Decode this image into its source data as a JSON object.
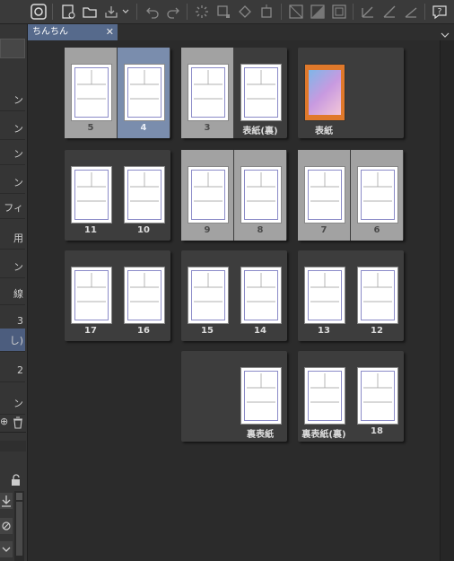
{
  "document_tab": {
    "title": "ちんちん",
    "close_glyph": "✕"
  },
  "left_panel": {
    "items": [
      "ン",
      "ン",
      "ン",
      "ン",
      "フィ",
      "用",
      "ン",
      "線",
      "3",
      "し)",
      "2",
      "ン"
    ]
  },
  "spreads": [
    {
      "pages": [
        {
          "label": "5",
          "state": "selected"
        },
        {
          "label": "4",
          "state": "active"
        }
      ]
    },
    {
      "pages": [
        {
          "label": "3",
          "state": "selected"
        },
        {
          "label": "表紙(裏)",
          "state": "normal"
        }
      ]
    },
    {
      "pages": [
        {
          "label": "表紙",
          "state": "normal",
          "cover": true
        }
      ]
    },
    {
      "pages": [
        {
          "label": "11",
          "state": "normal"
        },
        {
          "label": "10",
          "state": "normal"
        }
      ]
    },
    {
      "pages": [
        {
          "label": "9",
          "state": "selected"
        },
        {
          "label": "8",
          "state": "selected"
        }
      ]
    },
    {
      "pages": [
        {
          "label": "7",
          "state": "selected"
        },
        {
          "label": "6",
          "state": "selected"
        }
      ]
    },
    {
      "pages": [
        {
          "label": "17",
          "state": "normal"
        },
        {
          "label": "16",
          "state": "normal"
        }
      ]
    },
    {
      "pages": [
        {
          "label": "15",
          "state": "normal"
        },
        {
          "label": "14",
          "state": "normal"
        }
      ]
    },
    {
      "pages": [
        {
          "label": "13",
          "state": "normal"
        },
        {
          "label": "12",
          "state": "normal"
        }
      ]
    },
    {
      "pages": [
        {
          "label": "",
          "state": "empty"
        },
        {
          "label": "裏表紙",
          "state": "normal"
        }
      ]
    },
    {
      "pages": [
        {
          "label": "裏表紙(裏)",
          "state": "normal"
        },
        {
          "label": "18",
          "state": "normal"
        }
      ]
    }
  ],
  "toolbar_icons": [
    "app-logo-icon",
    "new-page-icon",
    "open-folder-icon",
    "save-icon",
    "undo-icon",
    "redo-icon",
    "loading-icon",
    "transform-icon",
    "fill-icon",
    "crop-icon",
    "deselect-icon",
    "invert-selection-icon",
    "frame-icon",
    "pen-icon",
    "brush-icon",
    "ruler-icon",
    "help-icon"
  ]
}
